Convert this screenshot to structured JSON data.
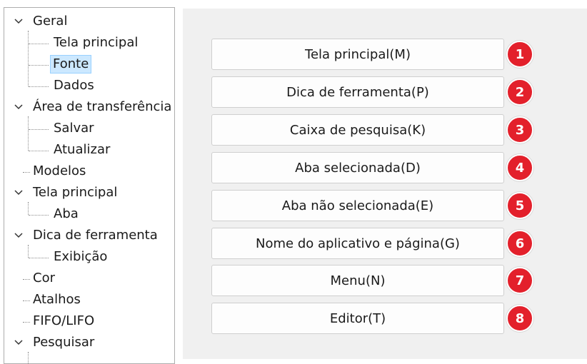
{
  "tree": {
    "items": [
      {
        "label": "Geral",
        "expanded": true
      },
      {
        "label": "Tela principal"
      },
      {
        "label": "Fonte",
        "selected": true
      },
      {
        "label": "Dados"
      },
      {
        "label": "Área de transferência",
        "expanded": true
      },
      {
        "label": "Salvar"
      },
      {
        "label": "Atualizar"
      },
      {
        "label": "Modelos"
      },
      {
        "label": "Tela principal",
        "expanded": true
      },
      {
        "label": "Aba"
      },
      {
        "label": "Dica de ferramenta",
        "expanded": true
      },
      {
        "label": "Exibição"
      },
      {
        "label": "Cor"
      },
      {
        "label": "Atalhos"
      },
      {
        "label": "FIFO/LIFO"
      },
      {
        "label": "Pesquisar",
        "expanded": true
      }
    ]
  },
  "font_buttons": [
    {
      "label": "Tela principal(M)",
      "badge": "1"
    },
    {
      "label": "Dica de ferramenta(P)",
      "badge": "2"
    },
    {
      "label": "Caixa de pesquisa(K)",
      "badge": "3"
    },
    {
      "label": "Aba selecionada(D)",
      "badge": "4"
    },
    {
      "label": "Aba não selecionada(E)",
      "badge": "5"
    },
    {
      "label": "Nome do aplicativo e página(G)",
      "badge": "6"
    },
    {
      "label": "Menu(N)",
      "badge": "7"
    },
    {
      "label": "Editor(T)",
      "badge": "8"
    }
  ],
  "colors": {
    "badge": "#e3202b",
    "selection": "#cce8ff",
    "panel_bg": "#f0f0f0"
  }
}
